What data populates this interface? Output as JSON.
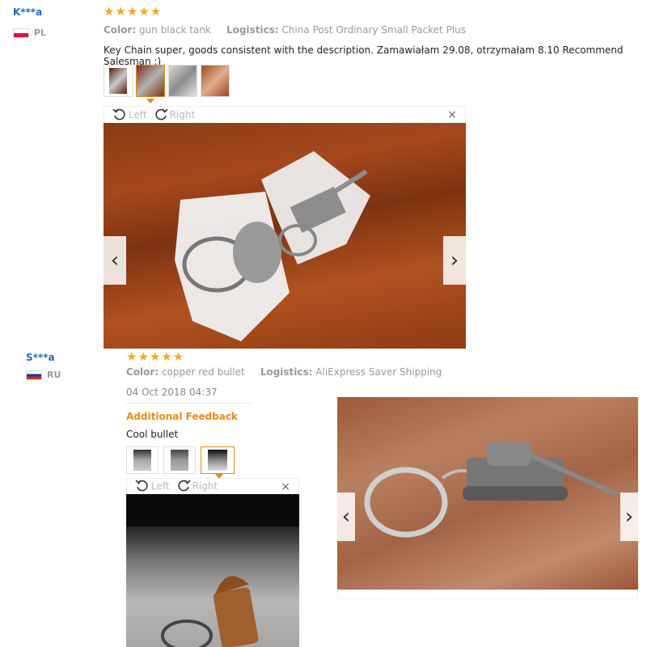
{
  "reviews": [
    {
      "name": "K***a",
      "country": "PL",
      "stars": "★★★★★",
      "color_label": "Color:",
      "color_value": "gun black tank",
      "logistics_label": "Logistics:",
      "logistics_value": "China Post Ordinary Small Packet Plus",
      "text": "Key Chain super, goods consistent with the description. Zamawiałam 29.08, otrzymałam 8.10 Recommend Salesman :)",
      "viewer": {
        "left": "Left",
        "right": "Right",
        "close": "×"
      }
    },
    {
      "name": "S***a",
      "country": "RU",
      "stars": "★★★★★",
      "color_label": "Color:",
      "color_value": "copper red bullet",
      "logistics_label": "Logistics:",
      "logistics_value": "AliExpress Saver Shipping",
      "date": "04 Oct 2018 04:37",
      "additional_label": "Additional Feedback",
      "additional_text": "Cool bullet",
      "viewer": {
        "left": "Left",
        "right": "Right",
        "close": "×"
      }
    }
  ],
  "icons": {
    "prev": "chevron-left-icon",
    "next": "chevron-right-icon",
    "rotate_left": "rotate-left-icon",
    "rotate_right": "rotate-right-icon"
  },
  "colors": {
    "name": "#1e6ab8",
    "stars": "#f5a623",
    "accent": "#e88a1a"
  }
}
